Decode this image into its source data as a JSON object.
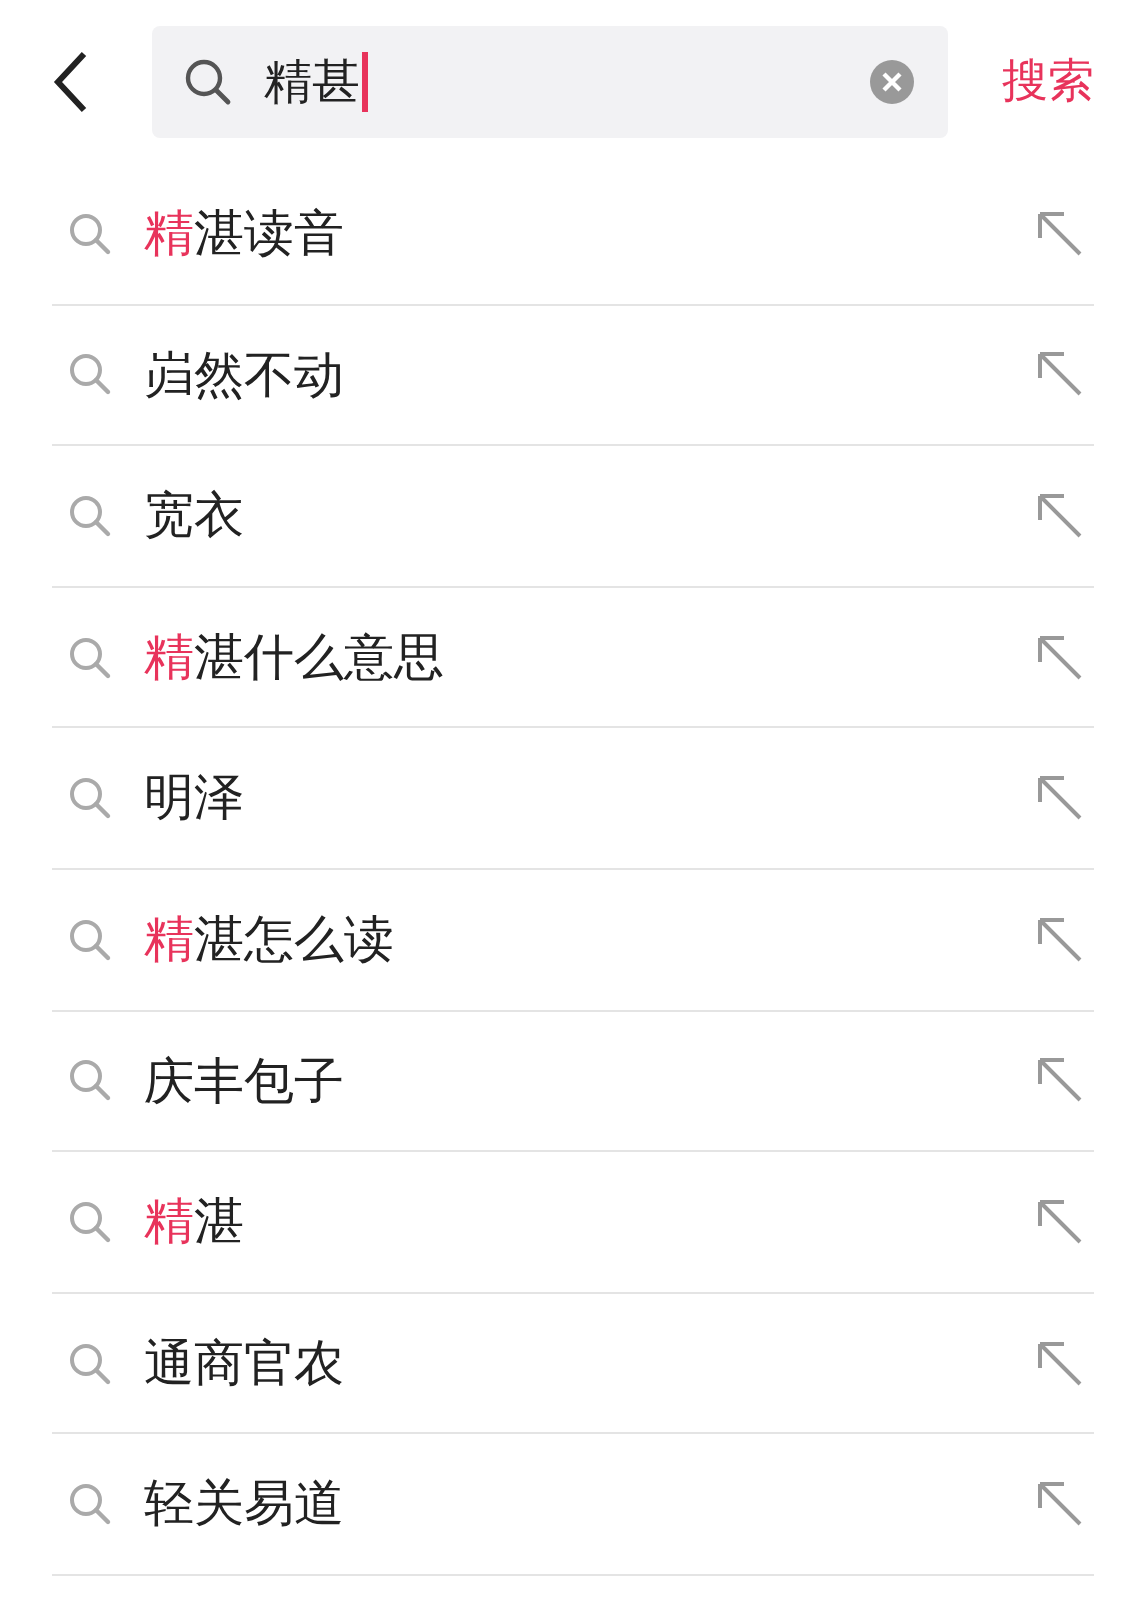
{
  "search": {
    "value": "精甚"
  },
  "search_button": "搜索",
  "suggestions": [
    {
      "highlight": "精",
      "rest": "湛读音"
    },
    {
      "rest": "岿然不动"
    },
    {
      "rest": "宽衣"
    },
    {
      "highlight": "精",
      "rest": "湛什么意思"
    },
    {
      "rest": "明泽"
    },
    {
      "highlight": "精",
      "rest": "湛怎么读"
    },
    {
      "rest": "庆丰包子"
    },
    {
      "highlight": "精",
      "rest": "湛"
    },
    {
      "rest": "通商官农"
    },
    {
      "rest": "轻关易道"
    }
  ]
}
